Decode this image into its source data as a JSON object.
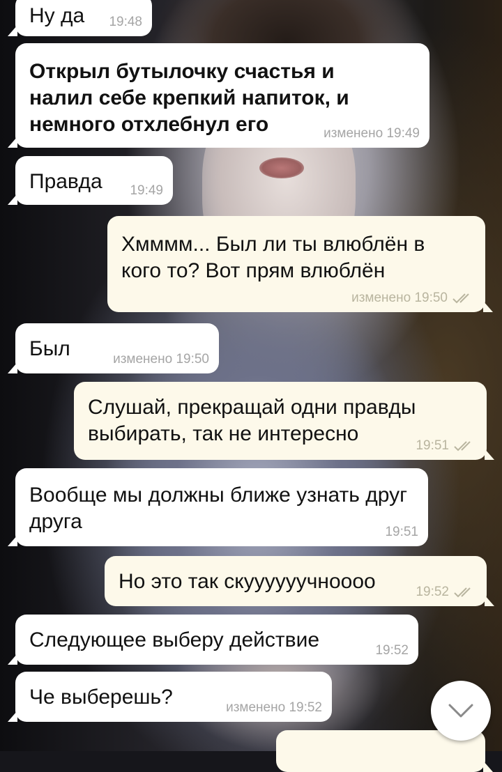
{
  "messages": [
    {
      "text": "Ну да",
      "meta": "19:48"
    },
    {
      "text": "Открыл бутылочку счастья и налил себе крепкий напиток, и немного отхлебнул его",
      "meta": "изменено 19:49"
    },
    {
      "text": "Правда",
      "meta": "19:49"
    },
    {
      "text": "Хмммм... Был ли ты влюблён в кого то? Вот прям влюблён",
      "meta": "изменено 19:50"
    },
    {
      "text": "Был",
      "meta": "изменено 19:50"
    },
    {
      "text": "Слушай, прекращай одни правды выбирать, так не интересно",
      "meta": "19:51"
    },
    {
      "text": "Вообще мы должны ближе узнать друг друга",
      "meta": "19:51"
    },
    {
      "text": "Но это так скуууууучноооо",
      "meta": "19:52"
    },
    {
      "text": "Следующее выберу действие",
      "meta": "19:52"
    },
    {
      "text": "Че выберешь?",
      "meta": "изменено 19:52"
    }
  ],
  "icons": {
    "read_receipt": "double-check-icon",
    "scroll_down": "chevron-down-icon"
  },
  "colors": {
    "incoming_bubble": "#ffffff",
    "outgoing_bubble": "#fdf9ea",
    "read_check": "#b9b59f"
  }
}
